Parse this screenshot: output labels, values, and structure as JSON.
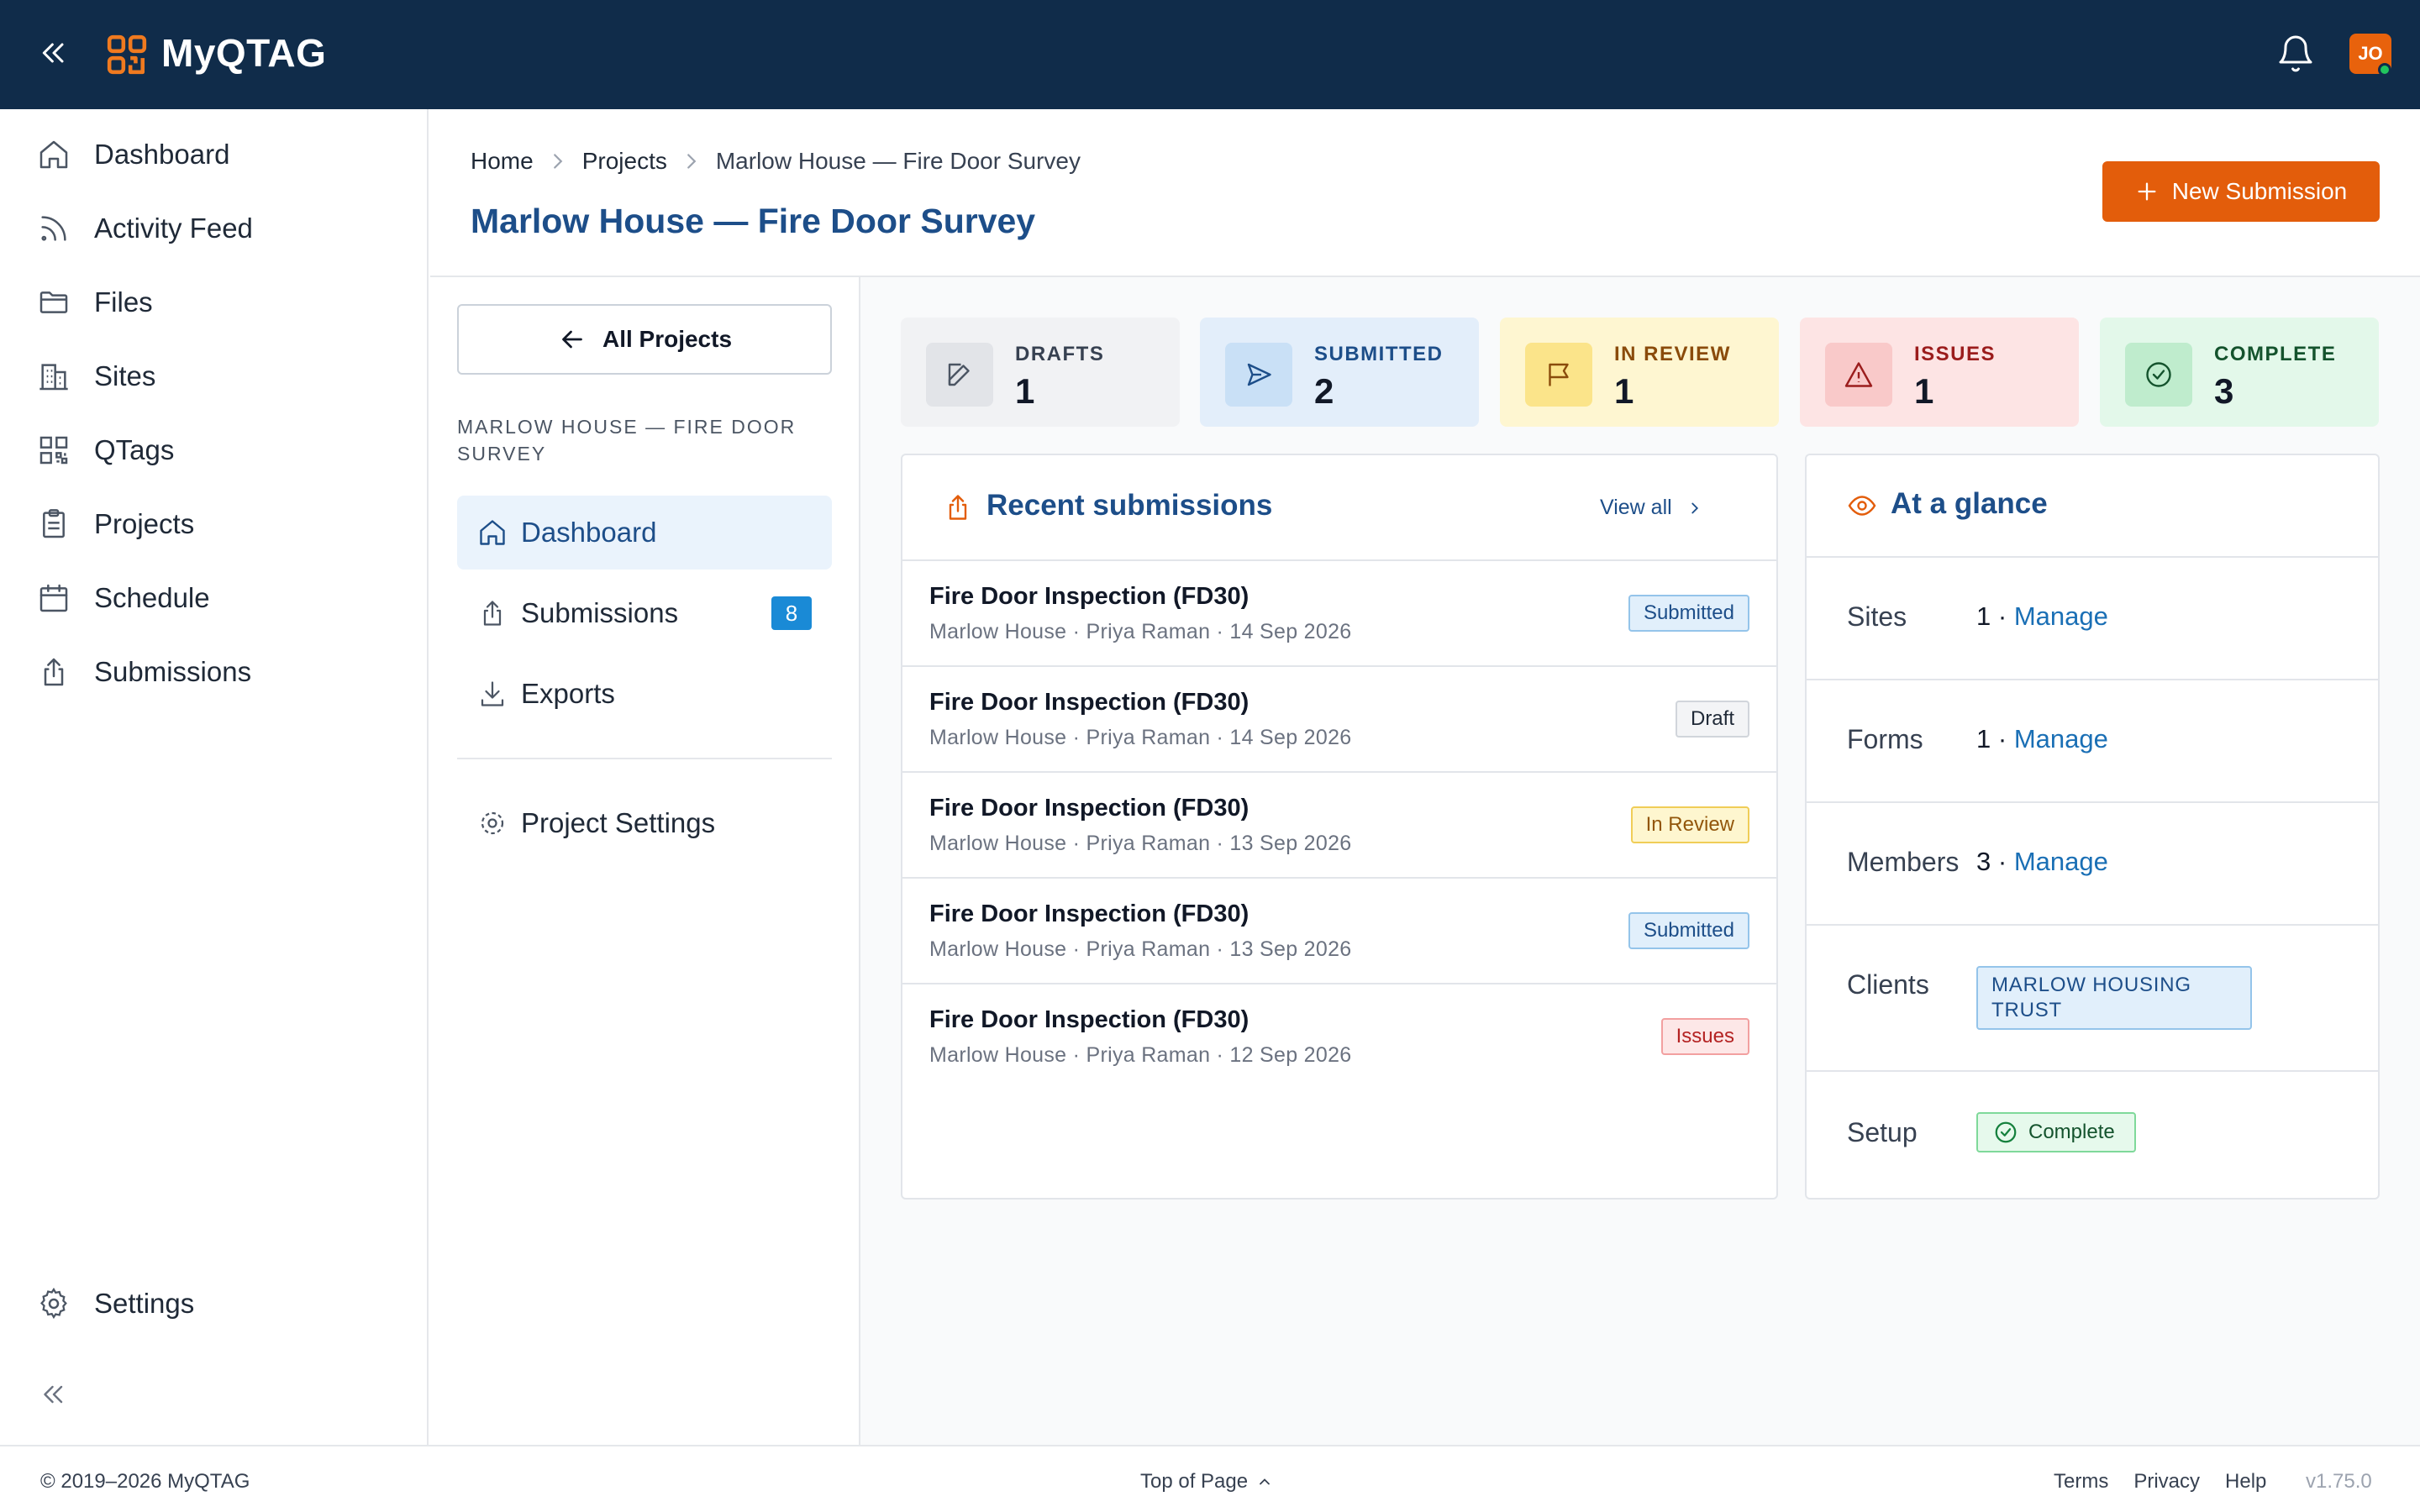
{
  "app": {
    "name": "MyQTAG",
    "avatar_initials": "JO",
    "brand_color": "#e8620c",
    "header_color": "#102c4a"
  },
  "sidebar": {
    "items": [
      {
        "label": "Dashboard",
        "icon": "home-icon"
      },
      {
        "label": "Activity Feed",
        "icon": "rss-icon"
      },
      {
        "label": "Files",
        "icon": "folder-icon"
      },
      {
        "label": "Sites",
        "icon": "building-icon"
      },
      {
        "label": "QTags",
        "icon": "qr-code-icon"
      },
      {
        "label": "Projects",
        "icon": "clipboard-icon"
      },
      {
        "label": "Schedule",
        "icon": "calendar-icon"
      },
      {
        "label": "Submissions",
        "icon": "share-icon"
      }
    ],
    "settings_label": "Settings"
  },
  "breadcrumb": {
    "home": "Home",
    "projects": "Projects",
    "current": "Marlow House — Fire Door Survey"
  },
  "page": {
    "title": "Marlow House — Fire Door Survey",
    "new_button": "New Submission"
  },
  "subnav": {
    "back_label": "All Projects",
    "heading": "MARLOW HOUSE — FIRE DOOR SURVEY",
    "items": [
      {
        "label": "Dashboard",
        "icon": "home-icon",
        "active": true
      },
      {
        "label": "Submissions",
        "icon": "share-icon",
        "badge": "8"
      },
      {
        "label": "Exports",
        "icon": "download-icon"
      }
    ],
    "settings_label": "Project Settings"
  },
  "stats": [
    {
      "label": "DRAFTS",
      "value": "1",
      "icon": "pencil-icon",
      "bg": "#f1f2f4",
      "iconbg": "#e2e4e8",
      "color": "#374151"
    },
    {
      "label": "SUBMITTED",
      "value": "2",
      "icon": "send-icon",
      "bg": "#e3eefa",
      "iconbg": "#c9e0f6",
      "color": "#1d4e89"
    },
    {
      "label": "IN REVIEW",
      "value": "1",
      "icon": "flag-icon",
      "bg": "#fef6d1",
      "iconbg": "#fbe48a",
      "color": "#8a4b0b"
    },
    {
      "label": "ISSUES",
      "value": "1",
      "icon": "warning-icon",
      "bg": "#fde4e4",
      "iconbg": "#f9c9c9",
      "color": "#9b1c1c"
    },
    {
      "label": "COMPLETE",
      "value": "3",
      "icon": "check-circle-icon",
      "bg": "#e3f8ea",
      "iconbg": "#bfeccd",
      "color": "#14532d"
    }
  ],
  "recent": {
    "title": "Recent submissions",
    "view_all": "View all",
    "rows": [
      {
        "title": "Fire Door Inspection (FD30)",
        "meta": "Marlow House · Priya Raman · 14 Sep 2026",
        "status": "Submitted",
        "kind": "submitted"
      },
      {
        "title": "Fire Door Inspection (FD30)",
        "meta": "Marlow House · Priya Raman · 14 Sep 2026",
        "status": "Draft",
        "kind": "draft"
      },
      {
        "title": "Fire Door Inspection (FD30)",
        "meta": "Marlow House · Priya Raman · 13 Sep 2026",
        "status": "In Review",
        "kind": "review"
      },
      {
        "title": "Fire Door Inspection (FD30)",
        "meta": "Marlow House · Priya Raman · 13 Sep 2026",
        "status": "Submitted",
        "kind": "submitted"
      },
      {
        "title": "Fire Door Inspection (FD30)",
        "meta": "Marlow House · Priya Raman · 12 Sep 2026",
        "status": "Issues",
        "kind": "issues"
      }
    ]
  },
  "glance": {
    "title": "At a glance",
    "sites": {
      "label": "Sites",
      "value": "1 ·",
      "link": "Manage"
    },
    "forms": {
      "label": "Forms",
      "value": "1 ·",
      "link": "Manage"
    },
    "members": {
      "label": "Members",
      "value": "3 ·",
      "link": "Manage"
    },
    "clients": {
      "label": "Clients",
      "tag": "MARLOW HOUSING TRUST"
    },
    "setup": {
      "label": "Setup",
      "tag": "Complete"
    }
  },
  "footer": {
    "copyright": "© 2019–2026 MyQTAG",
    "top": "Top of Page",
    "terms": "Terms",
    "privacy": "Privacy",
    "help": "Help",
    "version": "v1.75.0"
  }
}
